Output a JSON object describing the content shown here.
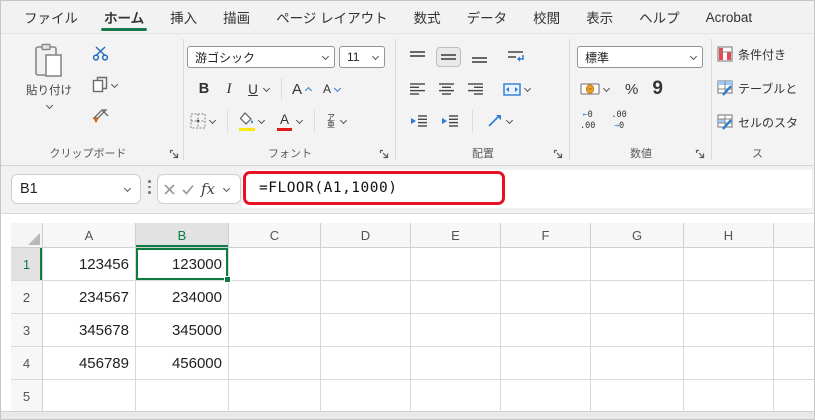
{
  "menu": {
    "tabs": [
      {
        "label": "ファイル",
        "active": false
      },
      {
        "label": "ホーム",
        "active": true
      },
      {
        "label": "挿入",
        "active": false
      },
      {
        "label": "描画",
        "active": false
      },
      {
        "label": "ページ レイアウト",
        "active": false
      },
      {
        "label": "数式",
        "active": false
      },
      {
        "label": "データ",
        "active": false
      },
      {
        "label": "校閲",
        "active": false
      },
      {
        "label": "表示",
        "active": false
      },
      {
        "label": "ヘルプ",
        "active": false
      },
      {
        "label": "Acrobat",
        "active": false
      }
    ]
  },
  "ribbon": {
    "clipboard": {
      "paste_label": "貼り付け",
      "group_label": "クリップボード"
    },
    "font": {
      "font_name": "游ゴシック",
      "font_size": "11",
      "bold": "B",
      "italic": "I",
      "underline": "U",
      "grow_font": "A",
      "shrink_font": "A",
      "font_color_letter": "A",
      "ruby_top": "ア",
      "ruby_bottom": "亜",
      "group_label": "フォント"
    },
    "alignment": {
      "group_label": "配置"
    },
    "number": {
      "format_value": "標準",
      "percent": "%",
      "comma": "9",
      "inc_arrow": "←",
      "inc_digit": "0",
      "inc_bottom": ".00",
      "dec_top": ".00",
      "dec_arrow": "→",
      "dec_digit": "0",
      "group_label": "数値"
    },
    "styles": {
      "conditional": "条件付き",
      "table": "テーブルと",
      "cell": "セルのスタ",
      "group_label": "ス"
    }
  },
  "formula_bar": {
    "name_box": "B1",
    "fx_label": "fx",
    "formula": "=FLOOR(A1,1000)"
  },
  "grid": {
    "columns": [
      "A",
      "B",
      "C",
      "D",
      "E",
      "F",
      "G",
      "H"
    ],
    "rows": [
      "1",
      "2",
      "3",
      "4",
      "5"
    ],
    "cells": [
      [
        "123456",
        "123000"
      ],
      [
        "234567",
        "234000"
      ],
      [
        "345678",
        "345000"
      ],
      [
        "456789",
        "456000"
      ]
    ],
    "selected_cell": "B1"
  },
  "colors": {
    "accent_green": "#107C41",
    "highlight_red": "#E81123"
  }
}
